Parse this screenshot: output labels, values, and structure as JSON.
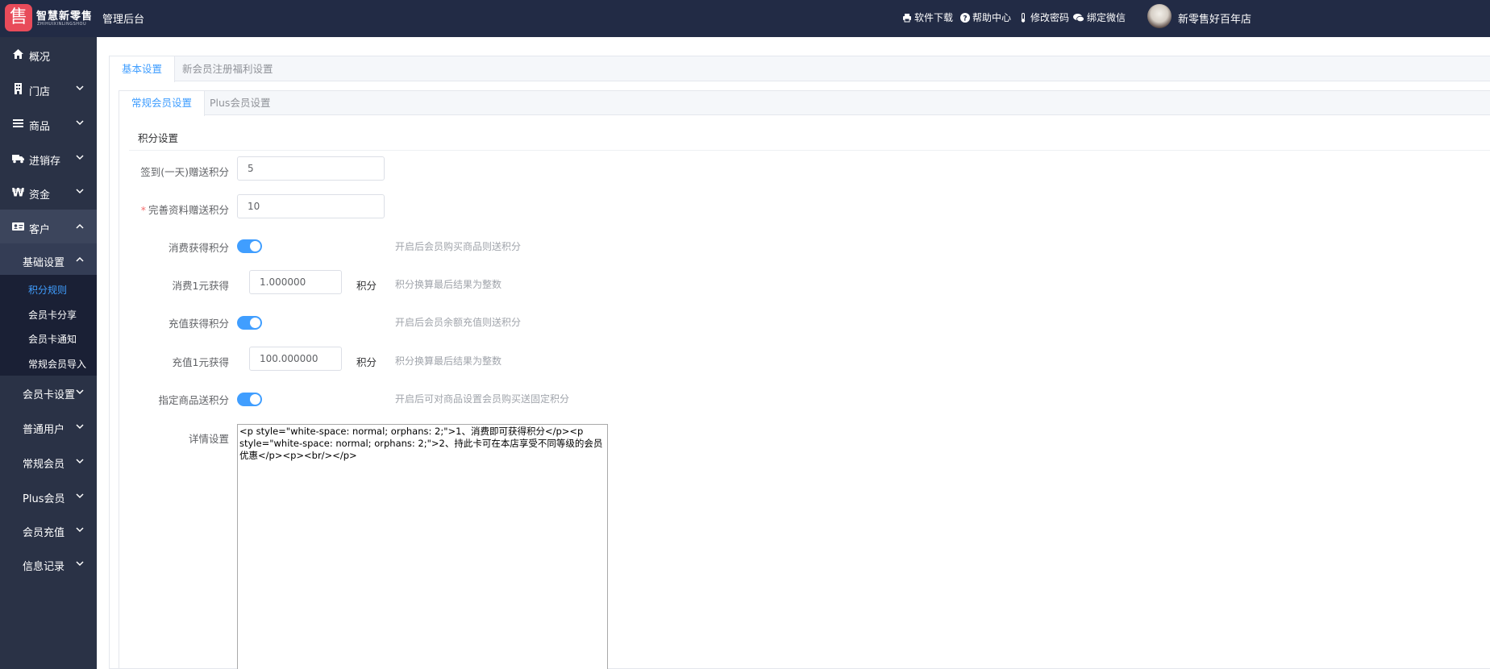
{
  "header": {
    "logo_name": "智慧新零售",
    "logo_sub": "ZHIHUIXINLINGSHOU",
    "logo_mark": "售",
    "admin_title": "管理后台",
    "nav": [
      {
        "label": "软件下载",
        "icon": "printer-icon"
      },
      {
        "label": "帮助中心",
        "icon": "question-circle-icon"
      },
      {
        "label": "修改密码",
        "icon": "thermometer-icon"
      },
      {
        "label": "绑定微信",
        "icon": "chat-bubbles-icon"
      }
    ],
    "user_name": "新零售好百年店"
  },
  "sidebar": {
    "items": [
      {
        "label": "概况",
        "icon": "home-icon"
      },
      {
        "label": "门店",
        "icon": "building-icon"
      },
      {
        "label": "商品",
        "icon": "list-icon"
      },
      {
        "label": "进销存",
        "icon": "truck-icon"
      },
      {
        "label": "资金",
        "icon": "won-icon"
      },
      {
        "label": "客户",
        "icon": "id-card-icon"
      }
    ],
    "sub_active": "基础设置",
    "subsub": [
      "积分规则",
      "会员卡分享",
      "会员卡通知",
      "常规会员导入"
    ],
    "sub_items": [
      "会员卡设置",
      "普通用户",
      "常规会员",
      "Plus会员",
      "会员充值",
      "信息记录"
    ]
  },
  "tabs_outer": [
    "基本设置",
    "新会员注册福利设置"
  ],
  "tabs_inner": [
    "常规会员设置",
    "Plus会员设置"
  ],
  "form": {
    "section_title": "积分设置",
    "checkin_label": "签到(一天)赠送积分",
    "checkin_value": "5",
    "profile_label": "完善资料赠送积分",
    "profile_required": "*",
    "profile_value": "10",
    "consume_switch_label": "消费获得积分",
    "consume_switch_on": true,
    "consume_switch_hint": "开启后会员购买商品则送积分",
    "consume_rate_label": "消费1元获得",
    "consume_rate_value": "1.000000",
    "consume_rate_unit": "积分",
    "consume_rate_hint": "积分换算最后结果为整数",
    "recharge_switch_label": "充值获得积分",
    "recharge_switch_on": true,
    "recharge_switch_hint": "开启后会员余额充值则送积分",
    "recharge_rate_label": "充值1元获得",
    "recharge_rate_value": "100.000000",
    "recharge_rate_unit": "积分",
    "recharge_rate_hint": "积分换算最后结果为整数",
    "goods_switch_label": "指定商品送积分",
    "goods_switch_on": true,
    "goods_switch_hint": "开启后可对商品设置会员购买送固定积分",
    "detail_label": "详情设置",
    "detail_value": "<p style=\"white-space: normal; orphans: 2;\">1、消费即可获得积分</p><p style=\"white-space: normal; orphans: 2;\">2、持此卡可在本店享受不同等级的会员优惠</p><p><br/></p>"
  },
  "colors": {
    "header_bg": "#222b45",
    "sidebar_bg": "#2a3246",
    "accent": "#409eff",
    "logo": "#e84b5a"
  }
}
